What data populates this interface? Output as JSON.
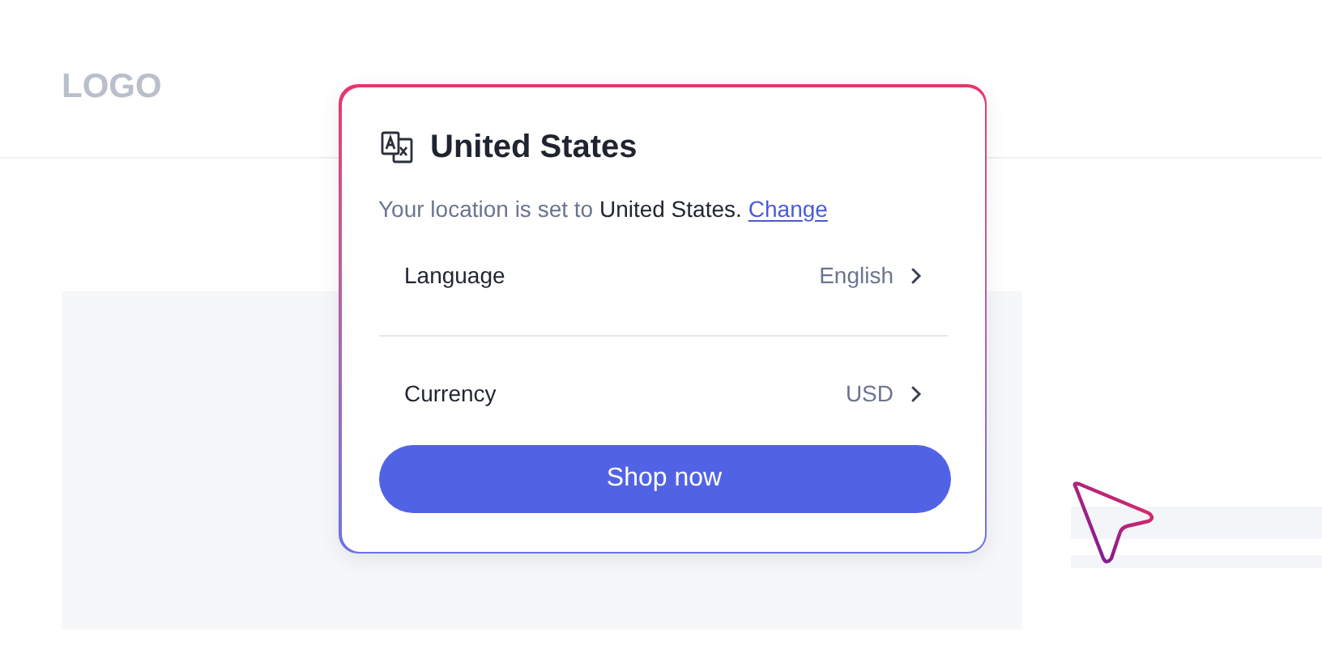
{
  "header": {
    "logo": "LOGO"
  },
  "popup": {
    "title": "United States",
    "location_text": "Your location is set to **United States.**",
    "change_link": "Change",
    "settings": [
      {
        "label": "Language",
        "value": "English"
      },
      {
        "label": "Currency",
        "value": "USD"
      }
    ],
    "button": "Shop now"
  }
}
